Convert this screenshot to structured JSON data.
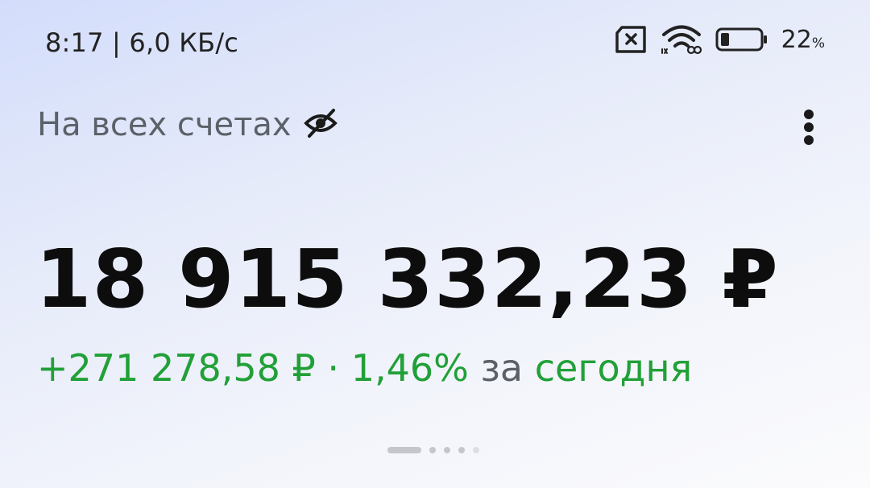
{
  "status_bar": {
    "time_speed": "8:17 | 6,0 КБ/с",
    "battery_value": "22",
    "battery_unit": "%",
    "icons": [
      "sim-error-icon",
      "wifi-icon",
      "battery-icon"
    ]
  },
  "header": {
    "title": "На всех счетах",
    "hide_icon": "eye-off-icon",
    "menu_icon": "more-vertical-icon"
  },
  "balance": {
    "total": "18 915 332,23 ₽",
    "change_amount": "+271 278,58 ₽",
    "separator": " · ",
    "change_percent": "1,46%",
    "period_prefix": " за ",
    "period": "сегодня"
  },
  "pager": {
    "page_count": 5,
    "current_page": 1
  },
  "colors": {
    "positive": "#21a038",
    "muted": "#5c6068",
    "primary_text": "#0d0d0d"
  }
}
